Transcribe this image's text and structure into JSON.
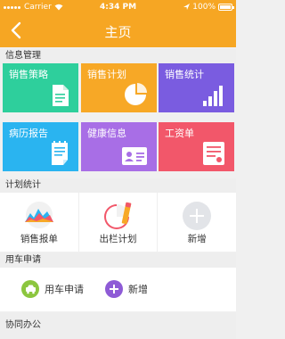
{
  "status_bar": {
    "carrier": "Carrier",
    "time": "4:34 PM",
    "battery": "100%"
  },
  "header": {
    "title": "主页"
  },
  "info": {
    "heading": "信息管理",
    "tiles": [
      {
        "label": "销售策略",
        "color": "#2ecf9c",
        "icon": "document-icon"
      },
      {
        "label": "销售计划",
        "color": "#f7a826",
        "icon": "pie-chart-icon"
      },
      {
        "label": "销售统计",
        "color": "#7a5ce0",
        "icon": "bar-chart-icon"
      },
      {
        "label": "病历报告",
        "color": "#2ab4f0",
        "icon": "notepad-icon"
      },
      {
        "label": "健康信息",
        "color": "#a86ee6",
        "icon": "id-card-icon"
      },
      {
        "label": "工资单",
        "color": "#f2576a",
        "icon": "payslip-icon"
      }
    ]
  },
  "plan": {
    "heading": "计划统计",
    "items": [
      {
        "label": "销售报单",
        "icon": "area-chart-icon"
      },
      {
        "label": "出栏计划",
        "icon": "pie-pencil-icon"
      },
      {
        "label": "新增",
        "icon": "add-icon"
      }
    ]
  },
  "car": {
    "heading": "用车申请",
    "items": [
      {
        "label": "用车申请",
        "icon": "car-icon",
        "color": "#8cc63f"
      },
      {
        "label": "新增",
        "icon": "add-icon",
        "color": "#8e5bd6"
      }
    ]
  },
  "collab": {
    "heading": "协同办公"
  }
}
